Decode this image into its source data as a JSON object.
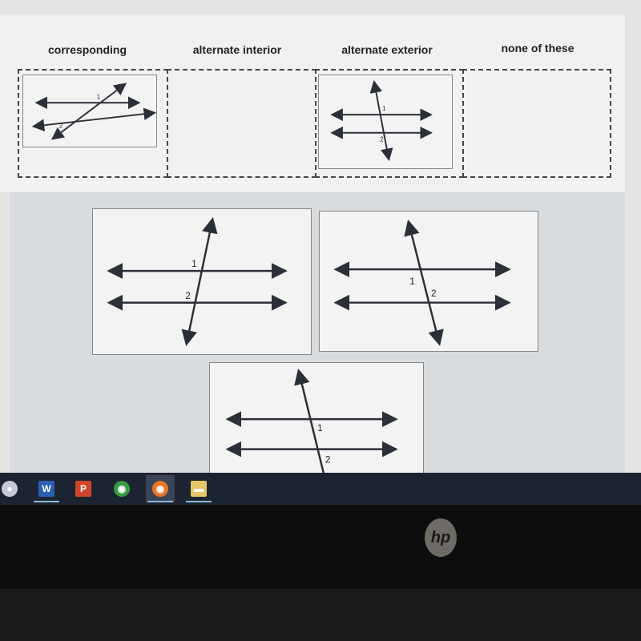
{
  "categories": [
    {
      "label": "corresponding"
    },
    {
      "label": "alternate interior"
    },
    {
      "label": "alternate exterior"
    },
    {
      "label": "none of these"
    }
  ],
  "cards": [
    {
      "id": "placed-corresponding",
      "angle1": "1",
      "angle2": "2"
    },
    {
      "id": "placed-alternate-exterior",
      "angle1": "1",
      "angle2": "2"
    },
    {
      "id": "bank-1",
      "angle1": "1",
      "angle2": "2"
    },
    {
      "id": "bank-2",
      "angle1": "1",
      "angle2": "2"
    },
    {
      "id": "bank-3",
      "angle1": "1",
      "angle2": "2"
    }
  ],
  "taskbar": {
    "apps": [
      "cortana-icon",
      "word-icon",
      "powerpoint-icon",
      "chrome-icon",
      "firefox-icon",
      "file-explorer-icon"
    ],
    "active": "firefox-icon"
  },
  "bezel": {
    "brand": "hp"
  },
  "colors": {
    "line": "#2b2f38",
    "panel": "#f1f1ef",
    "bank": "#d8dcdf",
    "taskbar": "#1d2431"
  }
}
